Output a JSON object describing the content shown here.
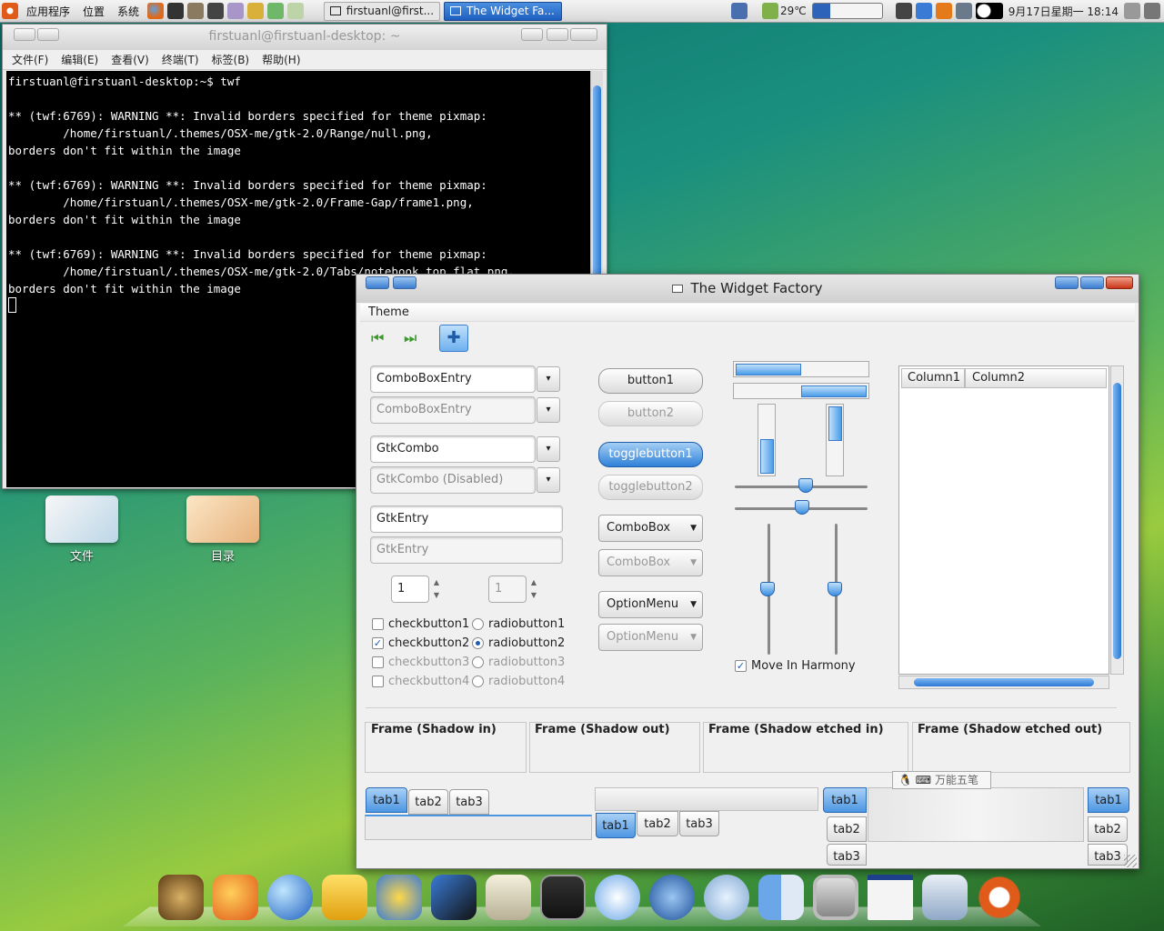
{
  "panel": {
    "menus": [
      "应用程序",
      "位置",
      "系统"
    ],
    "tasks": [
      {
        "label": "firstuanl@first...",
        "active": false
      },
      {
        "label": "The Widget Fa...",
        "active": true
      }
    ],
    "weather": "29℃",
    "clock": "9月17日星期一 18:14"
  },
  "terminal": {
    "title": "firstuanl@firstuanl-desktop: ~",
    "menu": [
      "文件(F)",
      "编辑(E)",
      "查看(V)",
      "终端(T)",
      "标签(B)",
      "帮助(H)"
    ],
    "lines": [
      "firstuanl@firstuanl-desktop:~$ twf",
      "",
      "** (twf:6769): WARNING **: Invalid borders specified for theme pixmap:",
      "        /home/firstuanl/.themes/OSX-me/gtk-2.0/Range/null.png,",
      "borders don't fit within the image",
      "",
      "** (twf:6769): WARNING **: Invalid borders specified for theme pixmap:",
      "        /home/firstuanl/.themes/OSX-me/gtk-2.0/Frame-Gap/frame1.png,",
      "borders don't fit within the image",
      "",
      "** (twf:6769): WARNING **: Invalid borders specified for theme pixmap:",
      "        /home/firstuanl/.themes/OSX-me/gtk-2.0/Tabs/notebook_top_flat.png,",
      "borders don't fit within the image"
    ]
  },
  "desktop": {
    "icons": [
      "文件",
      "目录"
    ]
  },
  "wf": {
    "title": "The Widget Factory",
    "menu": "Theme",
    "combos": [
      "ComboBoxEntry",
      "ComboBoxEntry",
      "GtkCombo",
      "GtkCombo (Disabled)"
    ],
    "entries": [
      "GtkEntry",
      "GtkEntry"
    ],
    "spins": [
      "1",
      "1"
    ],
    "checks": [
      "checkbutton1",
      "checkbutton2",
      "checkbutton3",
      "checkbutton4"
    ],
    "radios": [
      "radiobutton1",
      "radiobutton2",
      "radiobutton3",
      "radiobutton4"
    ],
    "buttons": [
      "button1",
      "button2",
      "togglebutton1",
      "togglebutton2"
    ],
    "combobox": [
      "ComboBox",
      "ComboBox"
    ],
    "optionmenu": [
      "OptionMenu",
      "OptionMenu"
    ],
    "harmony": "Move In Harmony",
    "columns": [
      "Column1",
      "Column2"
    ],
    "frames": [
      "Frame (Shadow in)",
      "Frame (Shadow out)",
      "Frame (Shadow etched in)",
      "Frame (Shadow etched out)"
    ],
    "tabs": [
      "tab1",
      "tab2",
      "tab3"
    ],
    "progress": {
      "h1": 0.5,
      "h2": 0.5,
      "v1": 0.5,
      "v2": 0.5
    }
  },
  "ime": "万能五笔"
}
